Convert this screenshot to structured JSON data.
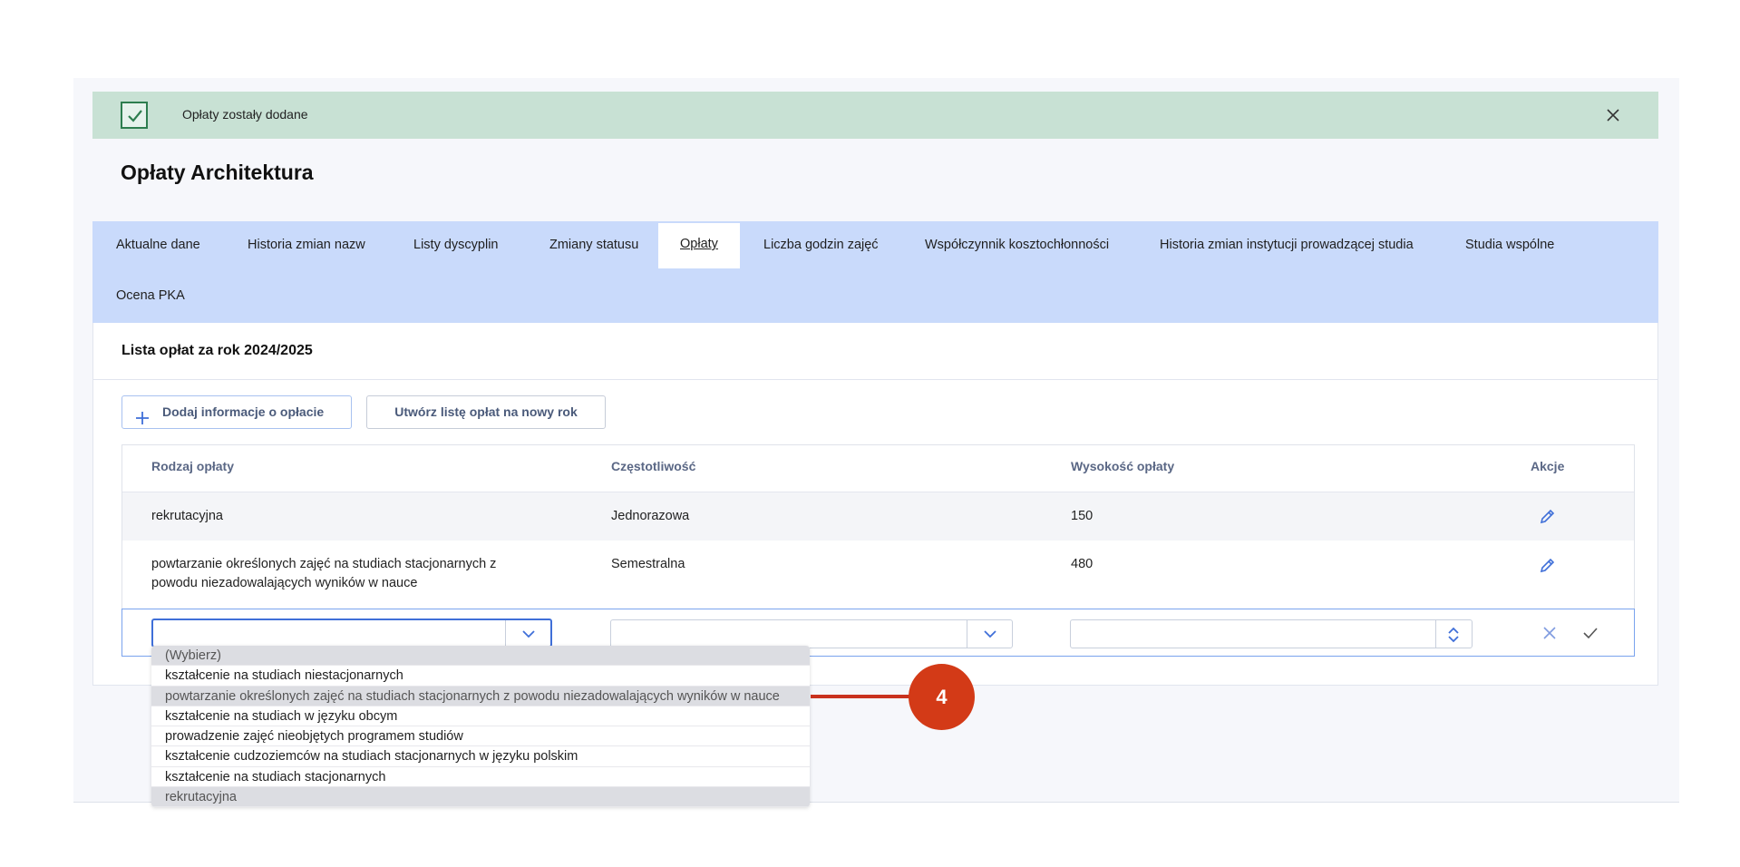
{
  "alert": {
    "message": "Opłaty zostały dodane",
    "icon": "checkbox-check-icon",
    "close_icon": "close-icon",
    "color": "#c8e1d4"
  },
  "page": {
    "title": "Opłaty Architektura"
  },
  "tabs": [
    {
      "label": "Aktualne dane"
    },
    {
      "label": "Historia zmian nazw"
    },
    {
      "label": "Listy dyscyplin"
    },
    {
      "label": "Zmiany statusu"
    },
    {
      "label": "Opłaty",
      "active": true
    },
    {
      "label": "Liczba godzin zajęć"
    },
    {
      "label": "Współczynnik kosztochłonności"
    },
    {
      "label": "Historia zmian instytucji prowadzącej studia"
    },
    {
      "label": "Studia wspólne"
    },
    {
      "label": "Ocena PKA"
    }
  ],
  "section": {
    "title": "Lista opłat za rok 2024/2025"
  },
  "toolbar": {
    "add_label": "Dodaj informacje o opłacie",
    "new_list_label": "Utwórz listę opłat na nowy rok"
  },
  "table": {
    "columns": [
      "Rodzaj opłaty",
      "Częstotliwość",
      "Wysokość opłaty",
      "Akcje"
    ],
    "rows": [
      {
        "type": "rekrutacyjna",
        "frequency": "Jednorazowa",
        "amount": "150"
      },
      {
        "type_line1": "powtarzanie określonych zajęć na studiach stacjonarnych z",
        "type_line2": "powodu niezadowalających wyników w nauce",
        "frequency": "Semestralna",
        "amount": "480"
      }
    ]
  },
  "dropdown": {
    "options": [
      "(Wybierz)",
      "kształcenie na studiach niestacjonarnych",
      "powtarzanie określonych zajęć na studiach stacjonarnych z powodu niezadowalających wyników w nauce",
      "kształcenie na studiach w języku obcym",
      "prowadzenie zajęć nieobjętych programem studiów",
      "kształcenie cudzoziemców na studiach stacjonarnych w języku polskim",
      "kształcenie na studiach stacjonarnych",
      "rekrutacyjna"
    ]
  },
  "callout": {
    "number": "4",
    "color": "#d33a17"
  },
  "colors": {
    "tabs_bg": "#c9dafb",
    "accent": "#3f6fd8"
  }
}
